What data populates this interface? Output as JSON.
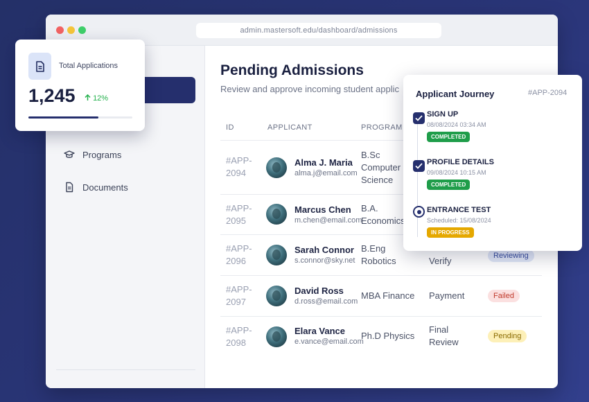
{
  "window": {
    "url": "admin.mastersoft.edu/dashboard/admissions"
  },
  "sidebar": {
    "items": [
      {
        "label": "Programs",
        "icon": "graduation-cap-icon"
      },
      {
        "label": "Documents",
        "icon": "document-icon"
      }
    ]
  },
  "page": {
    "title": "Pending Admissions",
    "subtitle": "Review and approve incoming student applic"
  },
  "table": {
    "columns": [
      "ID",
      "APPLICANT",
      "PROGRAM"
    ],
    "rows": [
      {
        "id": "#APP-\n2094",
        "name": "Alma J. Maria",
        "email": "alma.j@email.com",
        "program": "B.Sc\nComputer\nScience",
        "step": "",
        "status": ""
      },
      {
        "id": "#APP-\n2095",
        "name": "Marcus Chen",
        "email": "m.chen@email.com",
        "program": "B.A.\nEconomics",
        "step": "",
        "status": ""
      },
      {
        "id": "#APP-\n2096",
        "name": "Sarah Connor",
        "email": "s.connor@sky.net",
        "program": "B.Eng\nRobotics",
        "step": "Verify",
        "status": "Reviewing"
      },
      {
        "id": "#APP-\n2097",
        "name": "David Ross",
        "email": "d.ross@email.com",
        "program": "MBA Finance",
        "step": "Payment",
        "status": "Failed"
      },
      {
        "id": "#APP-\n2098",
        "name": "Elara Vance",
        "email": "e.vance@email.com",
        "program": "Ph.D Physics",
        "step": "Final\nReview",
        "status": "Pending"
      }
    ]
  },
  "stats": {
    "label": "Total Applications",
    "value": "1,245",
    "delta": "12%",
    "progress_fraction": 0.67
  },
  "journey": {
    "title": "Applicant Journey",
    "applicant_id": "#APP-2094",
    "steps": [
      {
        "name": "SIGN UP",
        "time": "08/08/2024 03:34 AM",
        "status": "COMPLETED"
      },
      {
        "name": "PROFILE DETAILS",
        "time": "09/08/2024 10:15 AM",
        "status": "COMPLETED"
      },
      {
        "name": "ENTRANCE TEST",
        "time": "Scheduled: 15/08/2024",
        "status": "IN PROGRESS"
      }
    ]
  },
  "colors": {
    "background": "#2a3578",
    "accent": "#252f6d",
    "success": "#22b04b",
    "warning": "#e5a800",
    "danger": "#c0392b",
    "info": "#3a4fa0"
  }
}
